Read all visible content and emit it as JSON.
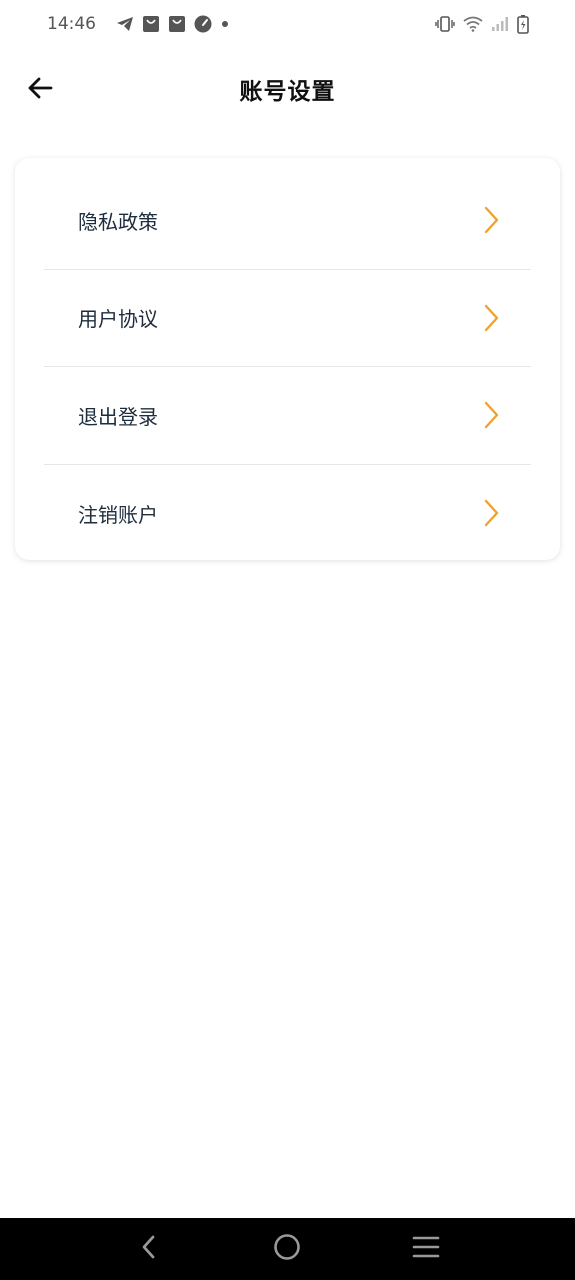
{
  "status_bar": {
    "time": "14:46",
    "left_icons": [
      "telegram-icon",
      "shopping-bag-icon",
      "shopping-bag-icon",
      "speedometer-icon",
      "dot-icon"
    ],
    "right_icons": [
      "vibrate-icon",
      "wifi-icon",
      "signal-icon",
      "battery-charging-icon"
    ]
  },
  "header": {
    "title": "账号设置",
    "back_icon": "arrow-left-icon"
  },
  "menu": {
    "items": [
      {
        "label": "隐私政策"
      },
      {
        "label": "用户协议"
      },
      {
        "label": "退出登录"
      },
      {
        "label": "注销账户"
      }
    ],
    "chevron_color": "#f0a32a"
  },
  "colors": {
    "background": "#ffffff",
    "text_primary": "#1d2d3d",
    "accent": "#f0a32a",
    "nav_bar": "#000000"
  },
  "nav_bar": {
    "buttons": [
      "back-triangle-icon",
      "home-circle-icon",
      "menu-lines-icon"
    ]
  }
}
